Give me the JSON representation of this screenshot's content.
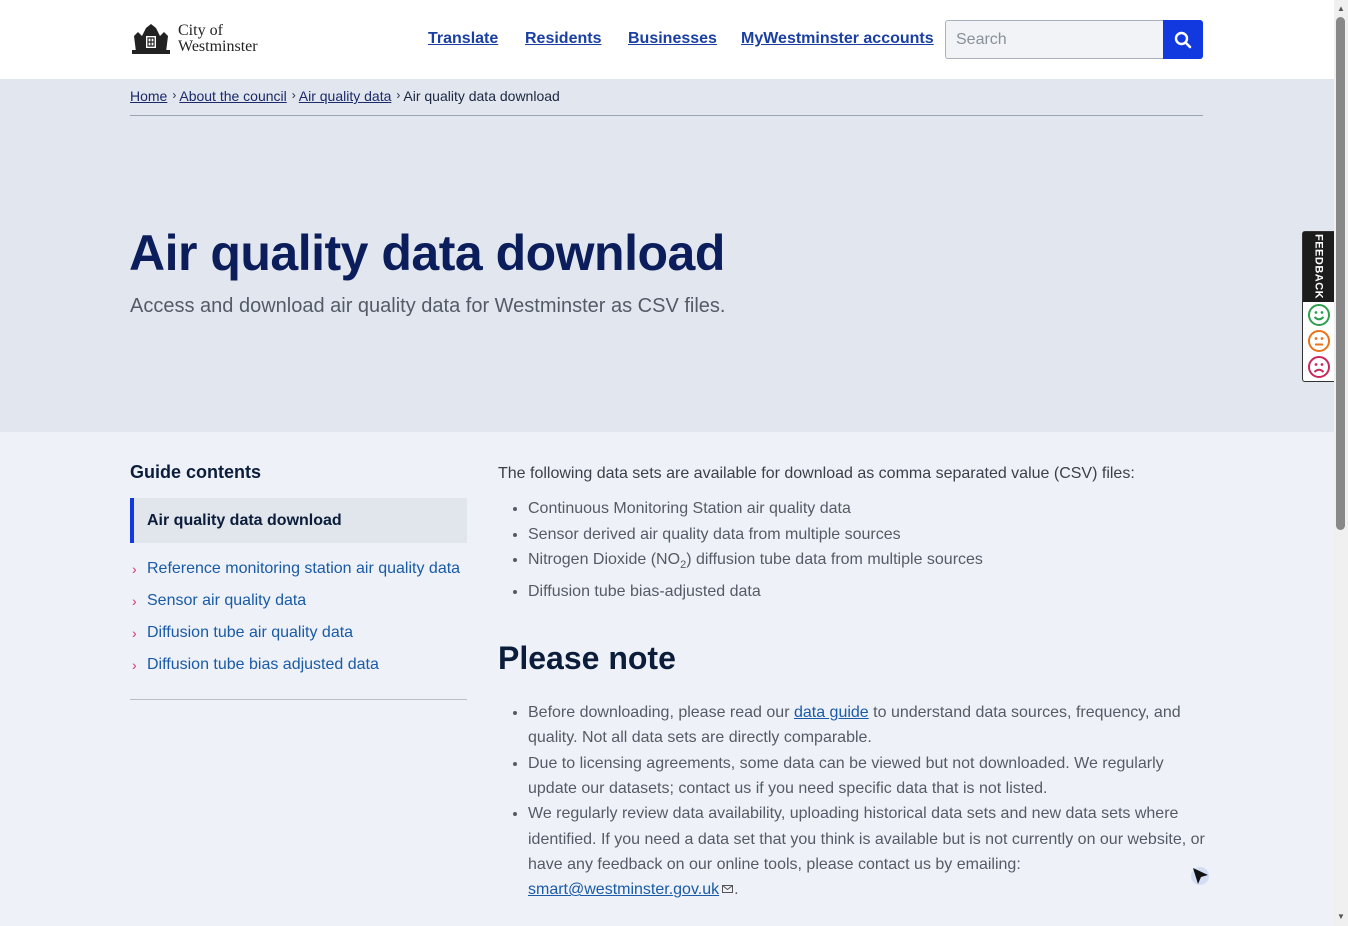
{
  "header": {
    "logo_line1": "City of",
    "logo_line2": "Westminster",
    "nav": [
      {
        "label": "Translate"
      },
      {
        "label": "Residents"
      },
      {
        "label": "Businesses"
      },
      {
        "label": "MyWestminster accounts"
      }
    ],
    "search_placeholder": "Search"
  },
  "breadcrumb": [
    {
      "label": "Home"
    },
    {
      "label": "About the council"
    },
    {
      "label": "Air quality data"
    },
    {
      "label": "Air quality data download"
    }
  ],
  "hero": {
    "title": "Air quality data download",
    "subtitle": "Access and download air quality data for Westminster as CSV files."
  },
  "sidebar": {
    "heading": "Guide contents",
    "current": "Air quality data download",
    "items": [
      {
        "label": "Reference monitoring station air quality data"
      },
      {
        "label": "Sensor air quality data"
      },
      {
        "label": "Diffusion tube air quality data"
      },
      {
        "label": "Diffusion tube bias adjusted data"
      }
    ]
  },
  "content": {
    "intro": "The following data sets are available for download as comma separated value (CSV) files:",
    "datasets": [
      "Continuous Monitoring Station air quality data",
      "Sensor derived air quality data from multiple sources",
      "Nitrogen Dioxide (NO",
      "Diffusion tube bias-adjusted data"
    ],
    "no2_sub": "2",
    "no2_tail": ") diffusion tube data from multiple sources",
    "note_heading": "Please note",
    "note1_before": "Before downloading, please read our ",
    "note1_link": "data guide",
    "note1_after": " to understand data sources, frequency, and quality. Not all data sets are directly comparable.",
    "note2": "Due to licensing agreements, some data can be viewed but not downloaded. We regularly update our datasets; contact us if you need specific data that is not listed.",
    "note3_before": "We regularly review data availability, uploading historical data sets and new data sets where identified. If you need a data set that you think is available but is not currently on our website, or have any feedback on our online tools, please contact us by emailing: ",
    "note3_link": "smart@westminster.gov.uk",
    "note3_after": "."
  },
  "feedback": {
    "label": "FEEDBACK",
    "faces": [
      "happy-face-icon",
      "neutral-face-icon",
      "sad-face-icon"
    ],
    "colors": {
      "happy": "#2e9e4f",
      "neutral": "#e8731a",
      "sad": "#c8285a"
    }
  },
  "colors": {
    "brand_blue": "#1238e0",
    "title_navy": "#0b1d5a",
    "link": "#1a5aa6",
    "chevron": "#d6336c"
  }
}
